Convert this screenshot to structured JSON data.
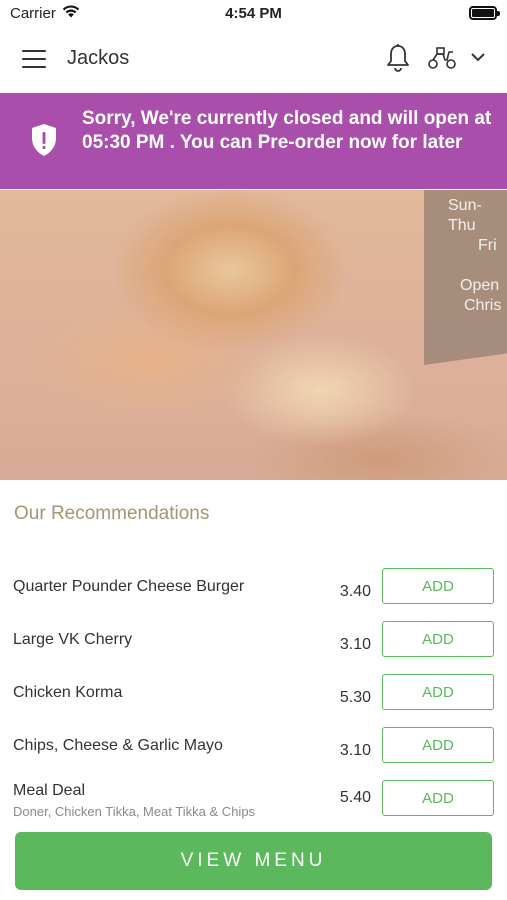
{
  "status_bar": {
    "carrier": "Carrier",
    "time": "4:54 PM"
  },
  "header": {
    "title": "Jackos",
    "icons": [
      "menu-icon",
      "bell-icon",
      "scooter-icon",
      "chevron-down-icon"
    ]
  },
  "banner": {
    "message": "Sorry, We're currently closed and will open at 05:30 PM . You can Pre-order now for later",
    "color": "#a94fab",
    "icon": "shield-alert-icon"
  },
  "hero": {
    "sign_lines": [
      "Sun-Thu",
      "Fri",
      "",
      "Open",
      "Chris"
    ]
  },
  "recommendations": {
    "title": "Our Recommendations",
    "items": [
      {
        "name": "Quarter Pounder Cheese Burger",
        "price": "3.40",
        "add": "ADD"
      },
      {
        "name": "Large VK Cherry",
        "price": "3.10",
        "add": "ADD"
      },
      {
        "name": "Chicken Korma",
        "price": "5.30",
        "add": "ADD"
      },
      {
        "name": "Chips, Cheese & Garlic Mayo",
        "price": "3.10",
        "add": "ADD"
      },
      {
        "name": "Meal Deal",
        "description": "Doner, Chicken Tikka, Meat Tikka & Chips",
        "price": "5.40",
        "add": "ADD"
      }
    ]
  },
  "footer": {
    "view_menu_label": "VIEW MENU",
    "accent_color": "#5cb85c"
  }
}
